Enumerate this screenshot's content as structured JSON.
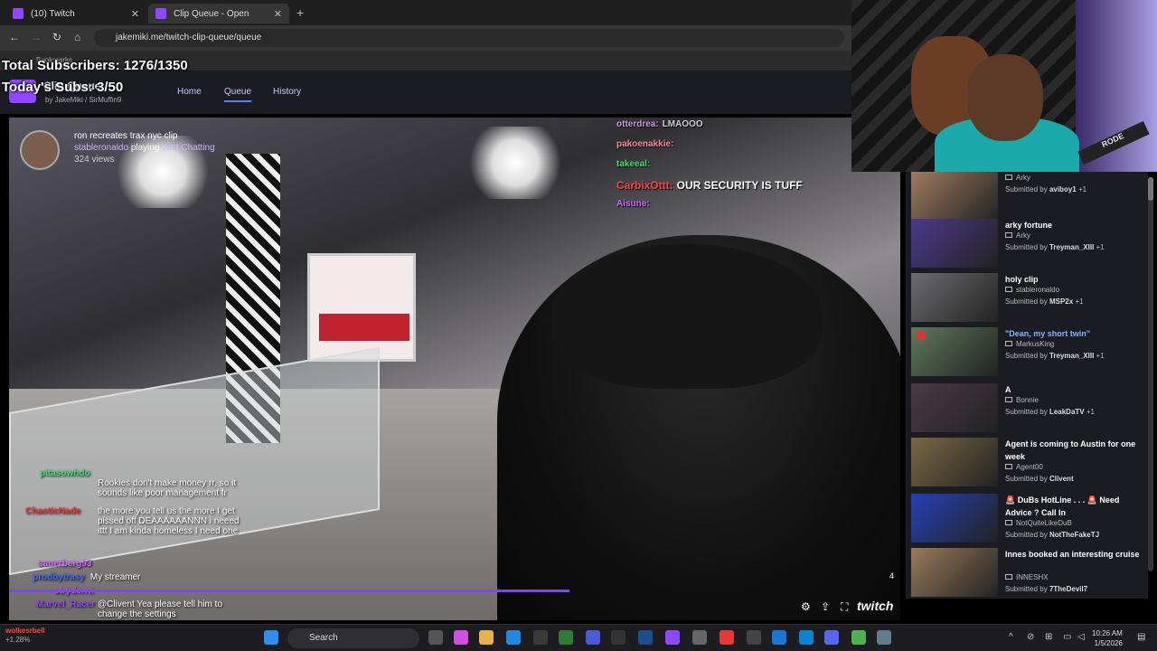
{
  "browser": {
    "tabs": [
      {
        "title": "(10) Twitch"
      },
      {
        "title": "Clip Queue - Open"
      }
    ],
    "url": "jakemiki.me/twitch-clip-queue/queue",
    "bookmarks": "Bookmarks"
  },
  "overlay": {
    "total_subs": "Total Subscribers: 1276/1350",
    "today_subs": "Today's Subs: 3/50"
  },
  "site": {
    "title": "Clip Queue",
    "byline_jake": "JakeMiki",
    "byline_sir": "SirMuffin9",
    "nav": [
      {
        "label": "Home"
      },
      {
        "label": "Queue"
      },
      {
        "label": "History"
      }
    ]
  },
  "clip": {
    "title": "ron recreates trax nyc clip",
    "streamer": "stableronaldo",
    "playing": "playing",
    "category": "Just Chatting",
    "views": "324 views",
    "counter": "4"
  },
  "video_chat": [
    {
      "user": "otterdrea:",
      "msg": "LMAOOO",
      "color": "#cc99dd"
    },
    {
      "user": "pakoenakkie:",
      "msg": "",
      "color": "#ff8899"
    },
    {
      "user": "takeeal:",
      "msg": "",
      "color": "#3fe070"
    },
    {
      "user": "CarbixOttt:",
      "msg": "OUR SECURITY IS TUFF",
      "color": "#ff4444"
    },
    {
      "user": "Aisune:",
      "msg": "",
      "color": "#cc66ff"
    }
  ],
  "stream_chat": [
    {
      "user": "pitasowhdo",
      "msg": "Rookies don't make money rr, so it sounds like poor management fr",
      "color": "#3fe070"
    },
    {
      "user": "ChaoticNade",
      "msg": "the more you tell us the more I get pissed off DEAAAAAANNN i neeed ittt I am kinda homeless I need one",
      "color": "#e33"
    },
    {
      "user": "sauerberg93",
      "msg": "",
      "color": "#cc66ff"
    },
    {
      "user": "prodbytrasy",
      "msg": "My streamer",
      "color": "#4466ff"
    },
    {
      "user": "stryderrx",
      "msg": "",
      "color": "#c04cff"
    },
    {
      "user": "Marvel_Racer",
      "msg": "@Clivent Yea please tell him to change the settings",
      "color": "#9146ff"
    }
  ],
  "queue": [
    {
      "title": "",
      "channel": "Arky",
      "submitted_by": "aviboy1",
      "extra": "+1",
      "thumb": "#a07a60"
    },
    {
      "title": "arky fortune",
      "channel": "Arky",
      "submitted_by": "Treyman_XIII",
      "extra": "+1",
      "thumb": "#4b3a8a"
    },
    {
      "title": "holy clip",
      "channel": "stableronaldo",
      "submitted_by": "MSP2x",
      "extra": "+1",
      "thumb": "#6d6d70"
    },
    {
      "title": "\"Dean, my short twin\"",
      "channel": "MarkusKing",
      "submitted_by": "Treyman_XIII",
      "extra": "+1",
      "thumb": "#5d7a5a"
    },
    {
      "title": "A",
      "channel": "Bonnie",
      "submitted_by": "LeakDaTV",
      "extra": "+1",
      "thumb": "#4a3a44"
    },
    {
      "title": "Agent is coming to Austin for one week",
      "channel": "Agent00",
      "submitted_by": "Clivent",
      "extra": "",
      "thumb": "#7a6845"
    },
    {
      "title": "🚨 DuBs HotLine . . . 🚨 Need Advice ? Call In",
      "channel": "NotQuiteLikeDuB",
      "submitted_by": "NotTheFakeTJ",
      "extra": "",
      "thumb": "#2440b8"
    },
    {
      "title": "Innes booked an interesting cruise",
      "channel": "INNESHX",
      "submitted_by": "7TheDevil7",
      "extra": "",
      "thumb": "#9a7a5a"
    }
  ],
  "queue_labels": {
    "submitted": "Submitted by"
  },
  "taskbar": {
    "ticker_name": "wolkesrbell",
    "ticker_change": "+1.28%",
    "search": "Search",
    "time": "10:26 AM",
    "date": "1/5/2026"
  },
  "webcam": {
    "mic_brand": "RODE"
  },
  "video_brand": "twitch"
}
